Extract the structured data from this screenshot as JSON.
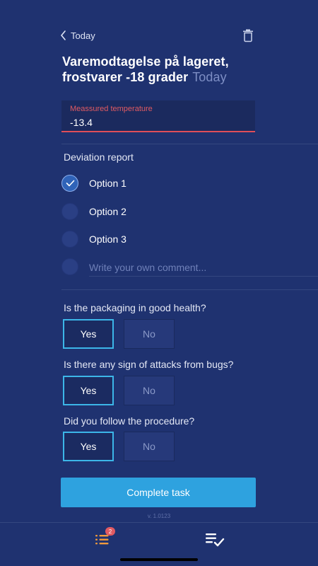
{
  "header": {
    "back_label": "Today",
    "title": "Varemodtagelse på lageret, frostvarer -18 grader",
    "title_date": "Today"
  },
  "temperature": {
    "label": "Meassured temperature",
    "value": "-13.4"
  },
  "deviation": {
    "heading": "Deviation report",
    "options": [
      {
        "label": "Option 1",
        "checked": true
      },
      {
        "label": "Option 2",
        "checked": false
      },
      {
        "label": "Option 3",
        "checked": false
      }
    ],
    "comment_placeholder": "Write your own comment..."
  },
  "questions": [
    {
      "text": "Is the packaging in good health?",
      "yes_label": "Yes",
      "no_label": "No",
      "selected": "Yes"
    },
    {
      "text": "Is there any sign of attacks from bugs?",
      "yes_label": "Yes",
      "no_label": "No",
      "selected": "Yes"
    },
    {
      "text": "Did you follow the procedure?",
      "yes_label": "Yes",
      "no_label": "No",
      "selected": "Yes"
    }
  ],
  "footer": {
    "complete_label": "Complete task",
    "version": "v. 1.0123"
  },
  "tabbar": {
    "tasks_badge": "2",
    "tasks_icon": "task-list-icon",
    "done_icon": "checklist-done-icon"
  },
  "colors": {
    "background": "#1f3270",
    "accent": "#2ea2df",
    "error": "#e05a62",
    "badge": "#e05a62",
    "tab_active": "#f29a3c"
  }
}
